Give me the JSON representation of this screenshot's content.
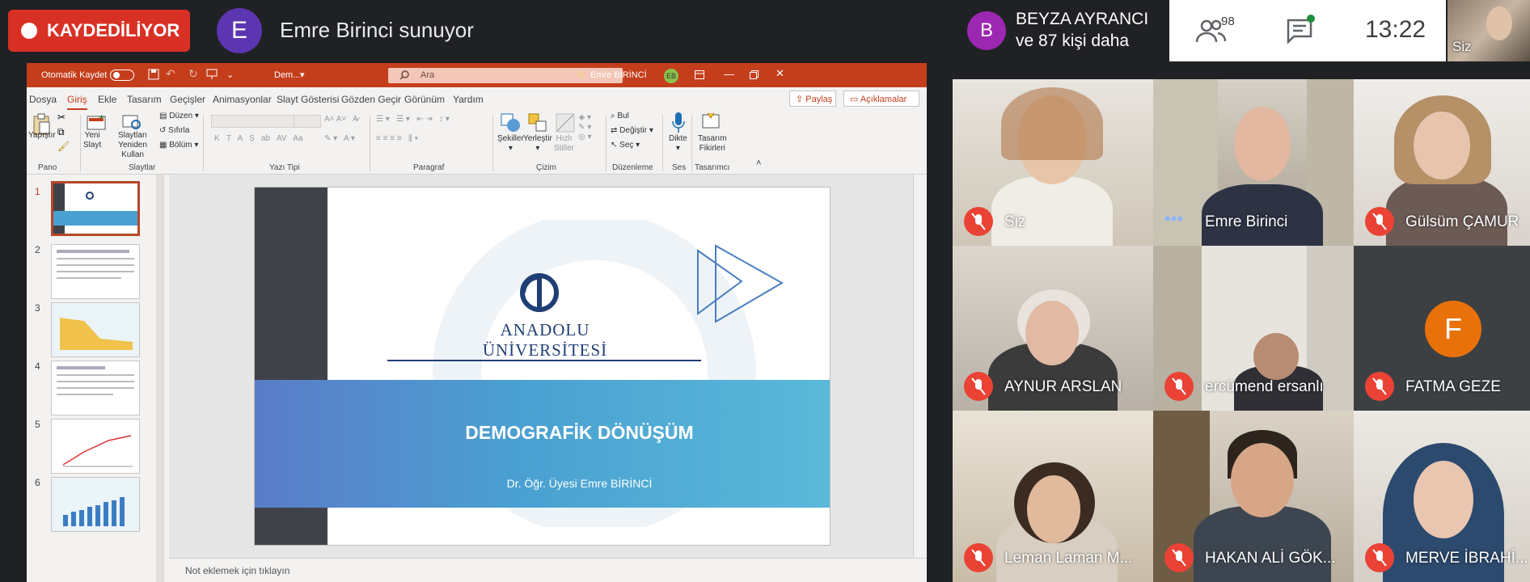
{
  "recording": {
    "label": "KAYDEDİLİYOR"
  },
  "presenter": {
    "initial": "E",
    "text": "Emre Birinci sunuyor"
  },
  "participants_header": {
    "initial": "B",
    "name": "BEYZA AYRANCI",
    "more": "ve 87 kişi daha",
    "count": "98",
    "time": "13:22",
    "self_label": "Siz"
  },
  "ppt": {
    "autosave": "Otomatik Kaydet",
    "doc_name": "Dem...",
    "search_placeholder": "Ara",
    "user": "Emre BİRİNCİ",
    "user_initials": "EB",
    "tabs": [
      "Dosya",
      "Giriş",
      "Ekle",
      "Tasarım",
      "Geçişler",
      "Animasyonlar",
      "Slayt Gösterisi",
      "Gözden Geçir",
      "Görünüm",
      "Yardım"
    ],
    "share": "Paylaş",
    "comments": "Açıklamalar",
    "ribbon": {
      "paste": "Yapıştır",
      "new_slide_1": "Yeni",
      "new_slide_2": "Slayt",
      "reuse_1": "Slaytları",
      "reuse_2": "Yeniden Kullan",
      "layout": "Düzen",
      "reset": "Sıfırla",
      "section": "Bölüm",
      "shapes": "Şekiller",
      "arrange": "Yerleştir",
      "quick_styles_1": "Hızlı",
      "quick_styles_2": "Stiller",
      "find": "Bul",
      "replace": "Değiştir",
      "select": "Seç",
      "dictate": "Dikte",
      "designer_1": "Tasarım",
      "designer_2": "Fikirleri",
      "groups": {
        "clipboard": "Pano",
        "slides": "Slaytlar",
        "font": "Yazı Tipi",
        "paragraph": "Paragraf",
        "drawing": "Çizim",
        "editing": "Düzenleme",
        "voice": "Ses",
        "designer": "Tasarımcı"
      }
    },
    "slide_numbers": [
      "1",
      "2",
      "3",
      "4",
      "5",
      "6"
    ],
    "slide": {
      "university": "ANADOLU ÜNİVERSİTESİ",
      "title": "DEMOGRAFİK DÖNÜŞÜM",
      "author": "Dr. Öğr. Üyesi  Emre BİRİNCİ"
    },
    "notes": "Not eklemek için tıklayın"
  },
  "tiles": [
    {
      "name": "Siz",
      "state": "muted"
    },
    {
      "name": "Emre Birinci",
      "state": "speaking"
    },
    {
      "name": "Gülsüm ÇAMUR",
      "state": "muted"
    },
    {
      "name": "AYNUR ARSLAN",
      "state": "muted"
    },
    {
      "name": "ercümend ersanlı",
      "state": "muted"
    },
    {
      "name": "FATMA GEZE",
      "state": "muted",
      "initial": "F"
    },
    {
      "name": "Leman Laman M...",
      "state": "muted"
    },
    {
      "name": "HAKAN ALİ GÖK...",
      "state": "muted"
    },
    {
      "name": "MERVE İBRAHİ...",
      "state": "muted"
    }
  ],
  "colors": {
    "record": "#d93025",
    "ppt_accent": "#c43e1c",
    "mute": "#ea4335",
    "avatar_f": "#e8710a"
  }
}
